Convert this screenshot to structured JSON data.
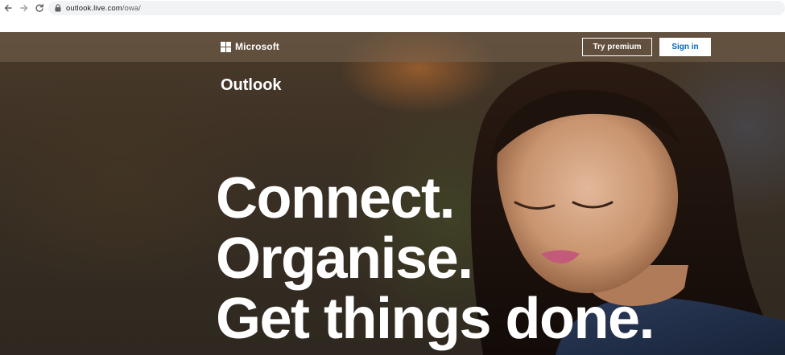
{
  "browser": {
    "url_host": "outlook.live.com",
    "url_path": "/owa/"
  },
  "header": {
    "logo_text": "Microsoft",
    "try_premium_label": "Try premium",
    "sign_in_label": "Sign in"
  },
  "hero": {
    "brand": "Outlook",
    "headline": [
      "Connect.",
      "Organise.",
      "Get things done."
    ]
  },
  "icons": {
    "back": "arrow-left-icon",
    "forward": "arrow-right-icon",
    "reload": "reload-icon",
    "lock": "lock-icon",
    "logo": "microsoft-logo-icon"
  },
  "colors": {
    "sign_in_text": "#0067b8",
    "headline": "#ffffff",
    "address_bar_bg": "#f1f3f4"
  }
}
